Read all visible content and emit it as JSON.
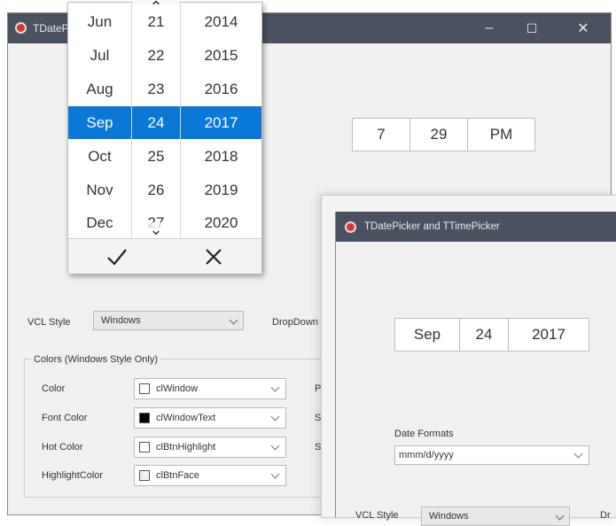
{
  "main_window": {
    "title": "TDatePicker and TTimePicker",
    "controls": {
      "minimize": "–",
      "maximize": "☐",
      "close": "✕"
    },
    "time_picker": {
      "hour": "7",
      "minute": "29",
      "ampm": "PM"
    },
    "vcl_style": {
      "label": "VCL Style",
      "value": "Windows"
    },
    "dropdown_label": "DropDown",
    "colors_group": {
      "title": "Colors (Windows Style Only)",
      "rows": [
        {
          "label": "Color",
          "value": "clWindow",
          "swatch": "#ffffff"
        },
        {
          "label": "Font Color",
          "value": "clWindowText",
          "swatch": "#000000"
        },
        {
          "label": "Hot Color",
          "value": "clBtnHighlight",
          "swatch": "#ffffff"
        },
        {
          "label": "HighlightColor",
          "value": "clBtnFace",
          "swatch": "#f0f0f0"
        }
      ],
      "side_letters": [
        "P",
        "S",
        "S"
      ]
    }
  },
  "date_dropdown": {
    "months": [
      "Jun",
      "Jul",
      "Aug",
      "Sep",
      "Oct",
      "Nov",
      "Dec"
    ],
    "days": [
      "21",
      "22",
      "23",
      "24",
      "25",
      "26",
      "27"
    ],
    "years": [
      "2014",
      "2015",
      "2016",
      "2017",
      "2018",
      "2019",
      "2020"
    ],
    "selected_row": 3,
    "accept": "✓",
    "cancel": "✕",
    "up_arrow": "⌃",
    "down_arrow": "⌄",
    "highlight_color": "#0a78d7"
  },
  "second_window": {
    "title": "TDatePicker and TTimePicker",
    "date_picker": {
      "month": "Sep",
      "day": "24",
      "year": "2017"
    },
    "date_formats": {
      "label": "Date Formats",
      "value": "mmm/d/yyyy"
    },
    "bottom_label_partial": "VCL Style",
    "bottom_value_partial": "Windows",
    "bottom_right_partial": "Dr"
  },
  "colors": {
    "titlebar": "#4a5160",
    "close_icon": "#d23a3a"
  }
}
